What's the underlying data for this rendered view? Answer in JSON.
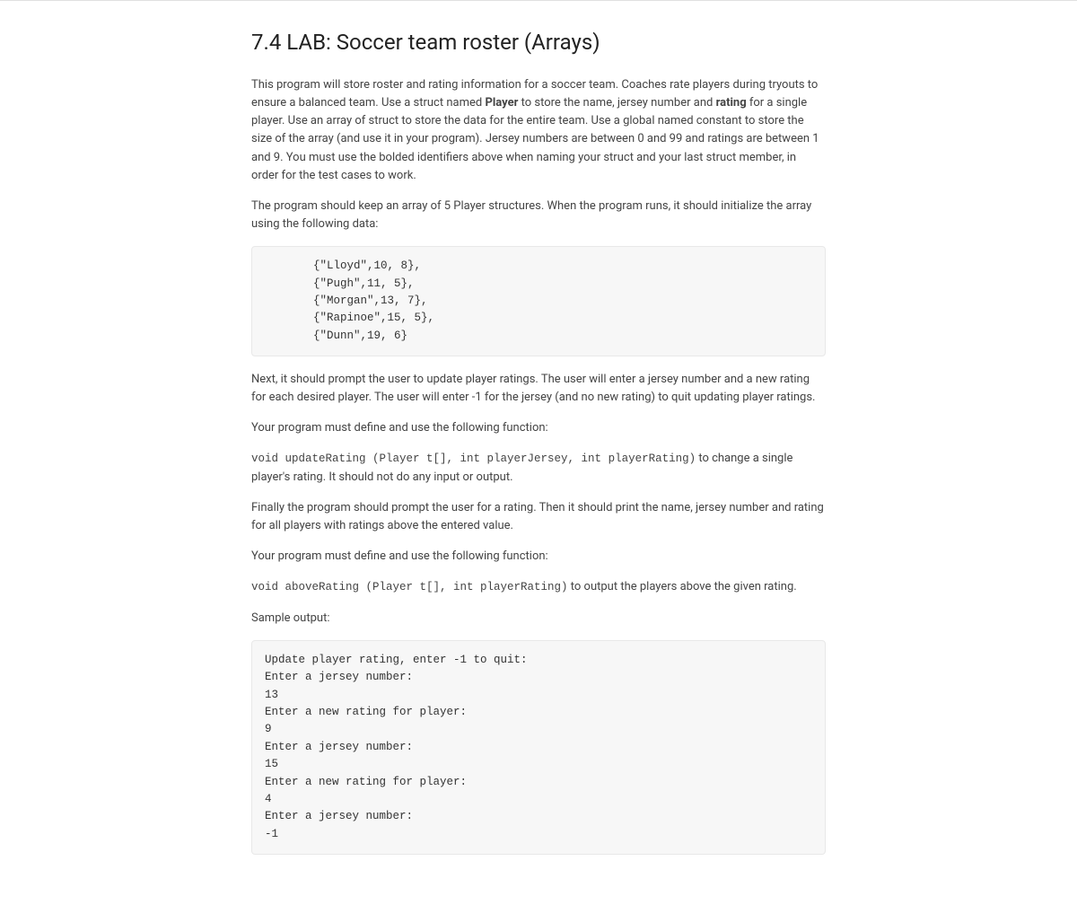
{
  "title": "7.4 LAB: Soccer team roster (Arrays)",
  "intro": {
    "p1_a": "This program will store roster and rating information for a soccer team. Coaches rate players during tryouts to ensure a balanced team. Use a struct named ",
    "p1_b": "Player",
    "p1_c": " to store the name, jersey number and ",
    "p1_d": "rating",
    "p1_e": " for a single player. Use an array of struct to store the data for the entire team. Use a global named constant to store the size of the array (and use it in your program). Jersey numbers are between 0 and 99 and ratings are between 1 and 9. You must use the bolded identifiers above when naming your struct and your last struct member, in order for the test cases to work.",
    "p2": "The program should keep an array of 5 Player structures. When the program runs, it should initialize the array using the following data:"
  },
  "init_data": "{\"Lloyd\",10, 8},\n{\"Pugh\",11, 5},\n{\"Morgan\",13, 7},\n{\"Rapinoe\",15, 5},\n{\"Dunn\",19, 6}",
  "mid": {
    "p1": "Next, it should prompt the user to update player ratings. The user will enter a jersey number and a new rating for each desired player. The user will enter -1 for the jersey (and no new rating) to quit updating player ratings.",
    "p2": "Your program must define and use the following function:",
    "fn1_code": "void updateRating (Player t[], int playerJersey, int playerRating)",
    "fn1_rest": " to change a single player's rating. It should not do any input or output.",
    "p3": "Finally the program should prompt the user for a rating. Then it should print the name, jersey number and rating for all players with ratings above the entered value.",
    "p4": "Your program must define and use the following function:",
    "fn2_code": "void aboveRating (Player t[], int playerRating)",
    "fn2_rest": " to output the players above the given rating.",
    "sample_label": "Sample output:"
  },
  "sample_output": "Update player rating, enter -1 to quit:\nEnter a jersey number:\n13\nEnter a new rating for player:\n9\nEnter a jersey number:\n15\nEnter a new rating for player:\n4\nEnter a jersey number:\n-1"
}
